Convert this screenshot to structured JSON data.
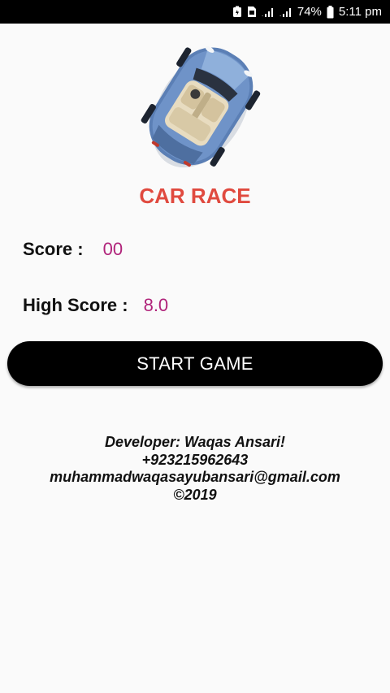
{
  "status_bar": {
    "icons": [
      "battery-saver-icon",
      "sim-icon",
      "signal-1-icon",
      "signal-2-icon",
      "battery-icon"
    ],
    "battery_percent": "74%",
    "time": "5:11 pm"
  },
  "app": {
    "logo_icon": "car-top-view-icon",
    "title": "CAR RACE",
    "score_label": "Score :",
    "score_value": "00",
    "high_score_label": "High Score :",
    "high_score_value": "8.0",
    "start_button": "START GAME"
  },
  "developer": {
    "line1": "Developer: Waqas Ansari!",
    "line2": "+923215962643",
    "line3": "muhammadwaqasayubansari@gmail.com",
    "line4": "©2019"
  },
  "colors": {
    "title": "#e04a3f",
    "value": "#b0237a",
    "button_bg": "#000000",
    "button_text": "#ffffff",
    "background": "#fafafa",
    "car_body": "#5b7fb5"
  }
}
